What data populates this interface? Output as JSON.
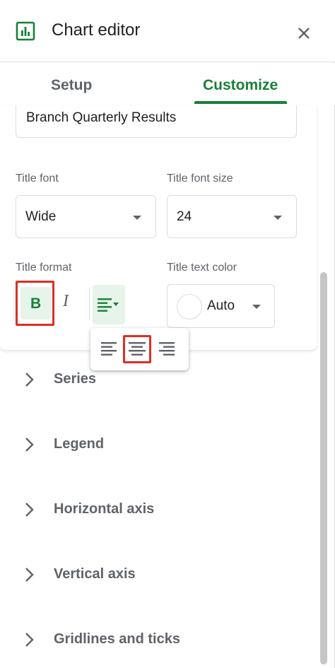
{
  "header": {
    "title": "Chart editor",
    "icon": "chart-bar-icon",
    "close_icon": "close-icon"
  },
  "tabs": [
    {
      "label": "Setup",
      "active": false
    },
    {
      "label": "Customize",
      "active": true
    }
  ],
  "chart_title_input": {
    "value": "Branch Quarterly Results"
  },
  "title_font": {
    "label": "Title font",
    "value": "Wide"
  },
  "title_font_size": {
    "label": "Title font size",
    "value": "24"
  },
  "title_format": {
    "label": "Title format",
    "bold_label": "B",
    "italic_label": "I",
    "bold_active": true
  },
  "title_text_color": {
    "label": "Title text color",
    "value": "Auto"
  },
  "align_options": [
    "align-left",
    "align-center",
    "align-right"
  ],
  "align_selected": "align-center",
  "sections": [
    {
      "label": "Series"
    },
    {
      "label": "Legend"
    },
    {
      "label": "Horizontal axis"
    },
    {
      "label": "Vertical axis"
    },
    {
      "label": "Gridlines and ticks"
    }
  ],
  "colors": {
    "accent": "#188038",
    "accent_bg": "#e6f4ea",
    "highlight": "#d93025",
    "text_secondary": "#5f6368"
  }
}
